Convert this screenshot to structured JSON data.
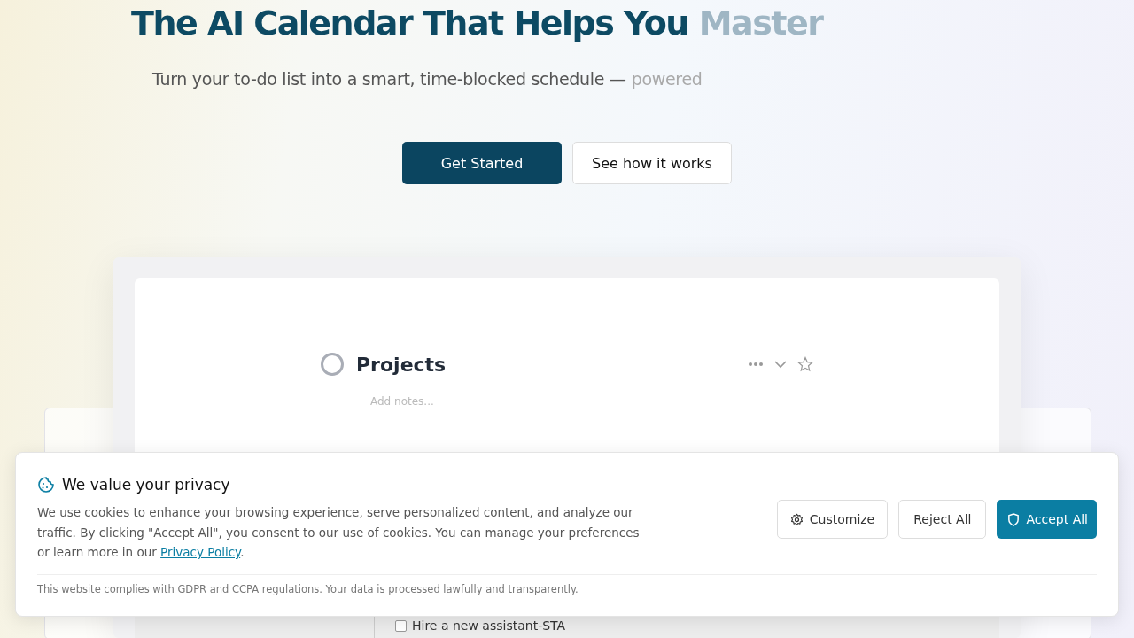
{
  "hero": {
    "title": "The AI Calendar That Helps You",
    "title_faded": "Master",
    "subtitle": "Turn your to-do list into a smart, time-blocked schedule —",
    "subtitle_faded": "powered",
    "buttons": [
      {
        "label": "Get Started",
        "kind": "primary"
      },
      {
        "label": "See how it works",
        "kind": "secondary"
      }
    ]
  },
  "preview": {
    "project": {
      "title": "Projects",
      "notes_placeholder": "Add notes...",
      "completed": false
    },
    "task": {
      "label": "Hire a new assistant-STA",
      "checked": false
    }
  },
  "cookie_banner": {
    "title": "We value your privacy",
    "text": "We use cookies to enhance your browsing experience, serve personalized content, and analyze our traffic. By clicking \"Accept All\", you consent to our use of cookies. You can manage your preferences or learn more in our",
    "link": "Privacy Policy",
    "text_end": ".",
    "buttons": [
      {
        "label": "Customize",
        "kind": "customize"
      },
      {
        "label": "Reject All",
        "kind": "reject"
      },
      {
        "label": "Accept All",
        "kind": "accept"
      }
    ],
    "footnote": "This website complies with GDPR and CCPA regulations. Your data is processed lawfully and transparently."
  }
}
